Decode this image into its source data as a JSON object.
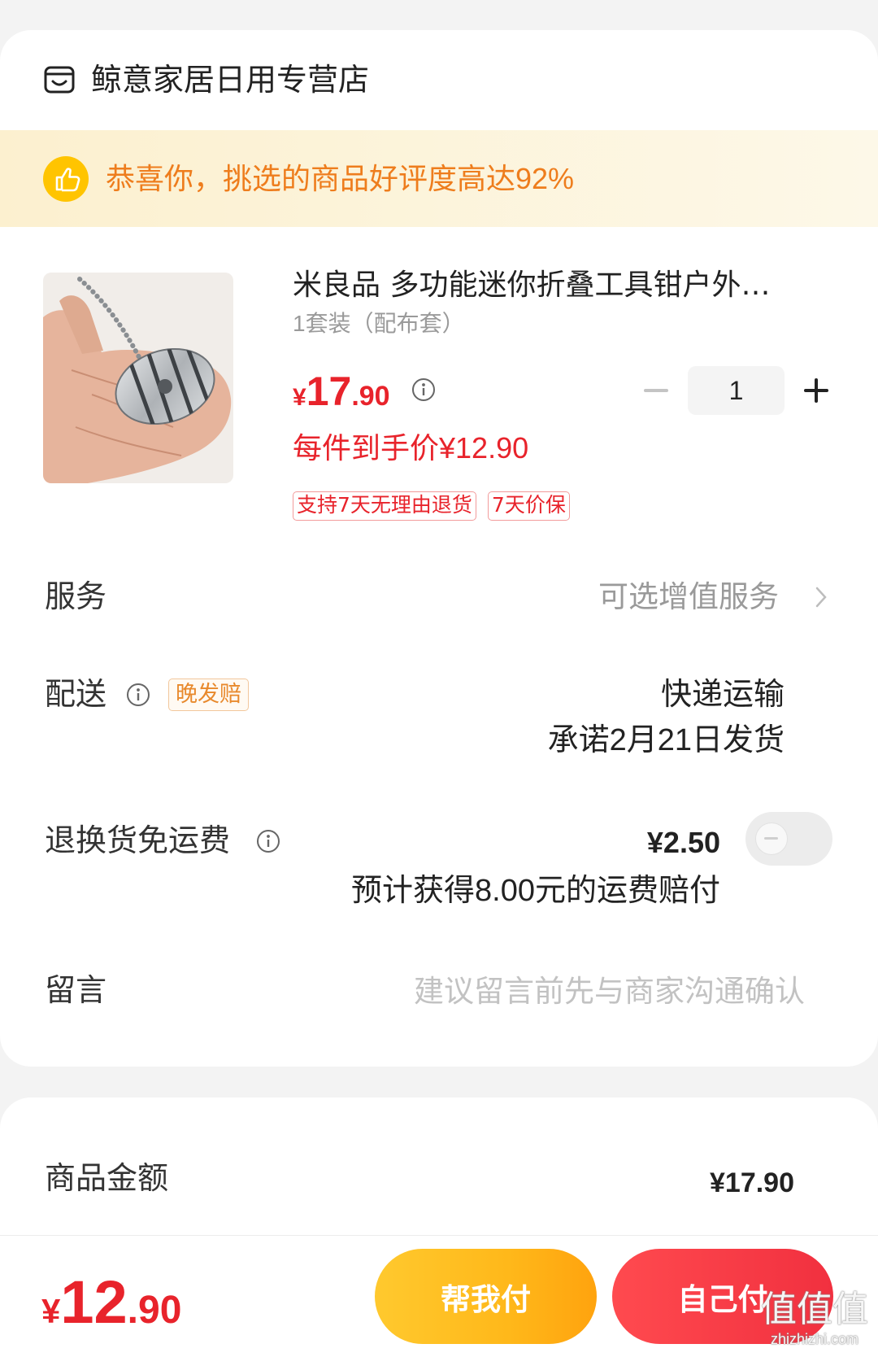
{
  "colors": {
    "background": "#f3f3f3",
    "price_red": "#e8232b",
    "banner_orange": "#ee7d1d",
    "help_pay_yellow": "#ffb81a",
    "self_pay_red": "#f1303f"
  },
  "shop": {
    "icon": "shop-icon",
    "name": "鲸意家居日用专营店"
  },
  "banner": {
    "icon": "thumbs-up-icon",
    "text": "恭喜你，挑选的商品好评度高达92%"
  },
  "product": {
    "title": "米良品 多功能迷你折叠工具钳户外…",
    "spec": "1套装（配布套）",
    "price": {
      "currency": "¥",
      "integer": "17",
      "decimal": ".90"
    },
    "final_price_text": "每件到手价¥12.90",
    "quantity": "1",
    "tags": [
      "支持7天无理由退货",
      "7天价保"
    ]
  },
  "service": {
    "label": "服务",
    "value": "可选增值服务"
  },
  "delivery": {
    "label": "配送",
    "badge": "晚发赔",
    "method": "快递运输",
    "promise": "承诺2月21日发货"
  },
  "return_shipping": {
    "label": "退换货免运费",
    "price": "¥2.50",
    "toggle_on": false,
    "note": "预计获得8.00元的运费赔付"
  },
  "message": {
    "label": "留言",
    "placeholder": "建议留言前先与商家沟通确认"
  },
  "summary": {
    "label": "商品金额",
    "value": "¥17.90"
  },
  "footer": {
    "total": {
      "currency": "¥",
      "integer": "12",
      "decimal": ".90"
    },
    "help_pay_label": "帮我付",
    "self_pay_label": "自己付"
  },
  "watermark": {
    "logo": "值值值",
    "site": "zhizhizhi.com"
  }
}
